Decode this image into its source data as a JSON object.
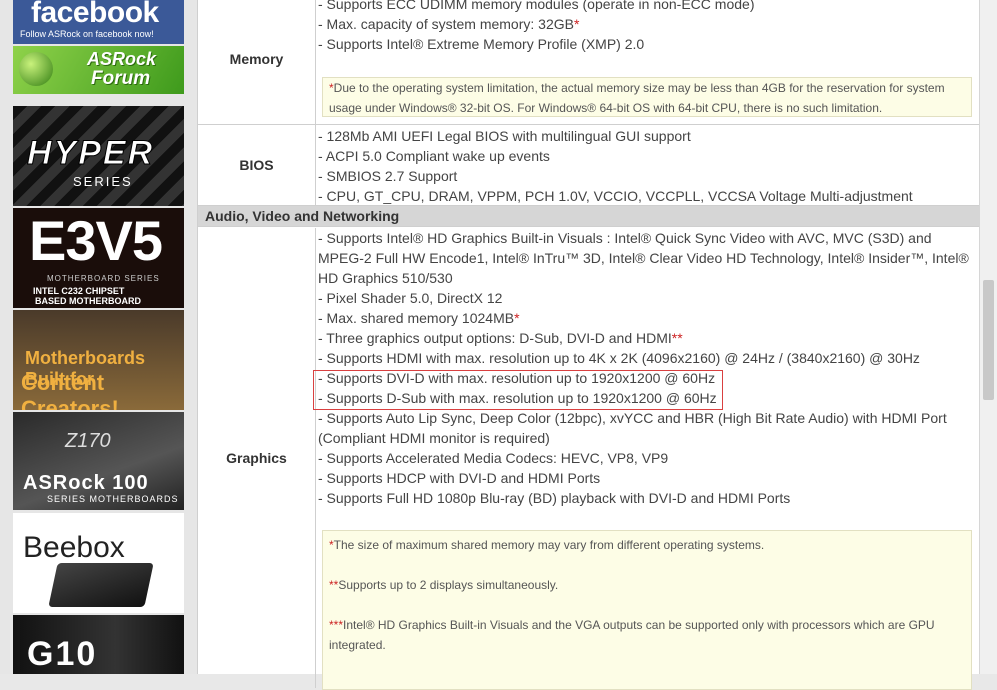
{
  "sidebar": {
    "facebook": {
      "title": "facebook",
      "subtitle": "Follow ASRock on facebook now!"
    },
    "forum": {
      "line1": "ASRock",
      "line2": "Forum"
    },
    "hyper": {
      "line1": "HYPER",
      "line2": "SERIES"
    },
    "e3v5": {
      "line1": "E3V5",
      "line2": "MOTHERBOARD SERIES",
      "line3": "INTEL C232 CHIPSET",
      "line4": "BASED MOTHERBOARD"
    },
    "content": {
      "line1": "Motherboards Built for",
      "line2": "Content Creators!"
    },
    "z170": {
      "line0": "Z170",
      "line1": "ASRock 100",
      "line2": "SERIES MOTHERBOARDS"
    },
    "beebox": {
      "title": "Beebox"
    },
    "g10": {
      "title": "G10"
    }
  },
  "memory": {
    "label": "Memory",
    "lines": [
      "- Supports ECC UDIMM memory modules (operate in non-ECC mode)",
      "- Max. capacity of system memory: 32GB",
      "- Supports Intel® Extreme Memory Profile (XMP) 2.0"
    ],
    "star": "*",
    "note_star": "*",
    "note_line1": "Due to the operating system limitation, the actual memory size may be less than 4GB for the reservation for system",
    "note_line2": "usage under Windows® 32-bit OS. For Windows® 64-bit OS with 64-bit CPU, there is no such limitation."
  },
  "bios": {
    "label": "BIOS",
    "lines": [
      "- 128Mb AMI UEFI Legal BIOS with multilingual GUI support",
      "- ACPI 5.0 Compliant wake up events",
      "- SMBIOS 2.7 Support",
      "- CPU, GT_CPU, DRAM, VPPM, PCH 1.0V, VCCIO, VCCPLL, VCCSA Voltage Multi-adjustment"
    ]
  },
  "section_title": "Audio, Video and Networking",
  "graphics": {
    "label": "Graphics",
    "lines": [
      "- Supports Intel® HD Graphics Built-in Visuals : Intel® Quick Sync Video with AVC, MVC (S3D) and",
      "MPEG-2 Full HW Encode1, Intel® InTru™ 3D, Intel® Clear Video HD Technology, Intel® Insider™, Intel®",
      "HD Graphics 510/530",
      "- Pixel Shader 5.0, DirectX 12",
      "- Max. shared memory 1024MB",
      "- Three graphics output options: D-Sub, DVI-D and HDMI",
      "- Supports HDMI with max. resolution up to 4K x 2K (4096x2160) @ 24Hz / (3840x2160) @ 30Hz",
      "- Supports DVI-D with max. resolution up to 1920x1200 @ 60Hz",
      "- Supports D-Sub with max. resolution up to 1920x1200 @ 60Hz",
      "- Supports Auto Lip Sync, Deep Color (12bpc), xvYCC and HBR (High Bit Rate Audio) with HDMI Port",
      "(Compliant HDMI monitor is required)",
      "- Supports Accelerated Media Codecs: HEVC, VP8, VP9",
      "- Supports HDCP with DVI-D and HDMI Ports",
      "- Supports Full HD 1080p Blu-ray (BD) playback with DVI-D and HDMI Ports"
    ],
    "star1": "*",
    "star2": "**",
    "notes": {
      "n1_star": "*",
      "n1": "The size of maximum shared memory may vary from different operating systems.",
      "n2_star": "**",
      "n2": "Supports up to 2 displays simultaneously.",
      "n3_star": "***",
      "n3_a": "Intel® HD Graphics Built-in Visuals and the VGA outputs can be supported only with processors which are GPU",
      "n3_b": "integrated."
    }
  }
}
